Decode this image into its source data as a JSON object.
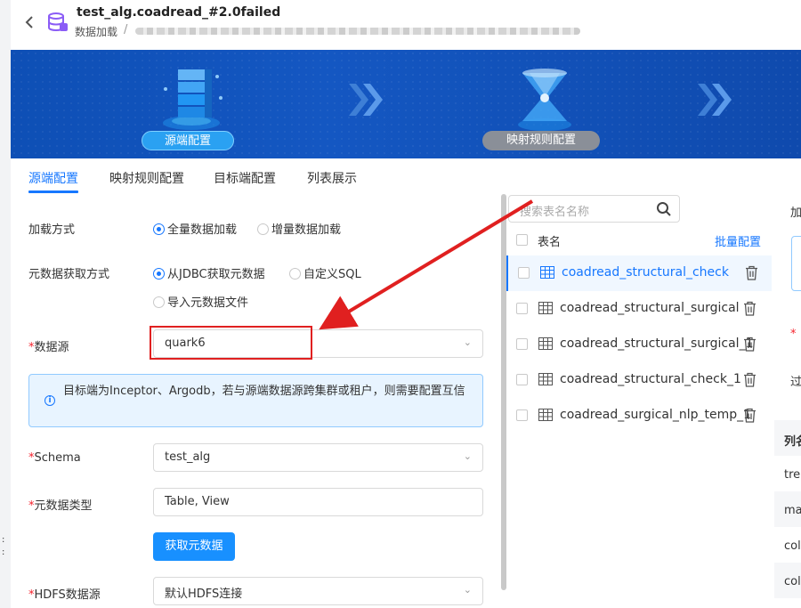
{
  "header": {
    "title": "test_alg.coadread_#2.0failed",
    "breadcrumb": "数据加载",
    "separator": "/"
  },
  "banner": {
    "step1": "源端配置",
    "step2": "映射规则配置"
  },
  "tabs": [
    "源端配置",
    "映射规则配置",
    "目标端配置",
    "列表展示"
  ],
  "form": {
    "load_mode_label": "加载方式",
    "load_mode_options": [
      "全量数据加载",
      "增量数据加载"
    ],
    "meta_mode_label": "元数据获取方式",
    "meta_mode_options": [
      "从JDBC获取元数据",
      "自定义SQL",
      "导入元数据文件"
    ],
    "datasource_label": "数据源",
    "datasource_value": "quark6",
    "info_text": "目标端为Inceptor、Argodb，若与源端数据源跨集群或租户，则需要配置互信",
    "schema_label": "Schema",
    "schema_value": "test_alg",
    "meta_type_label": "元数据类型",
    "meta_type_value": "Table, View",
    "fetch_button": "获取元数据",
    "hdfs_label": "HDFS数据源",
    "hdfs_value": "默认HDFS连接",
    "required_mark": "*"
  },
  "table_list": {
    "search_placeholder": "搜索表名名称",
    "header_label": "表名",
    "batch_config": "批量配置",
    "rows": [
      "coadread_structural_check",
      "coadread_structural_surgical",
      "coadread_structural_surgical_1",
      "coadread_structural_check_1",
      "coadread_surgical_nlp_temp_1"
    ]
  },
  "right_panel": {
    "t1": "加",
    "t2": "*",
    "t3": "过",
    "t4": "列名",
    "t5": "tre",
    "t6": "ma",
    "t7": "col",
    "t8": "col"
  },
  "colors": {
    "primary": "#1677ff",
    "banner": "#0e4fb5",
    "annotation": "#e02020"
  }
}
